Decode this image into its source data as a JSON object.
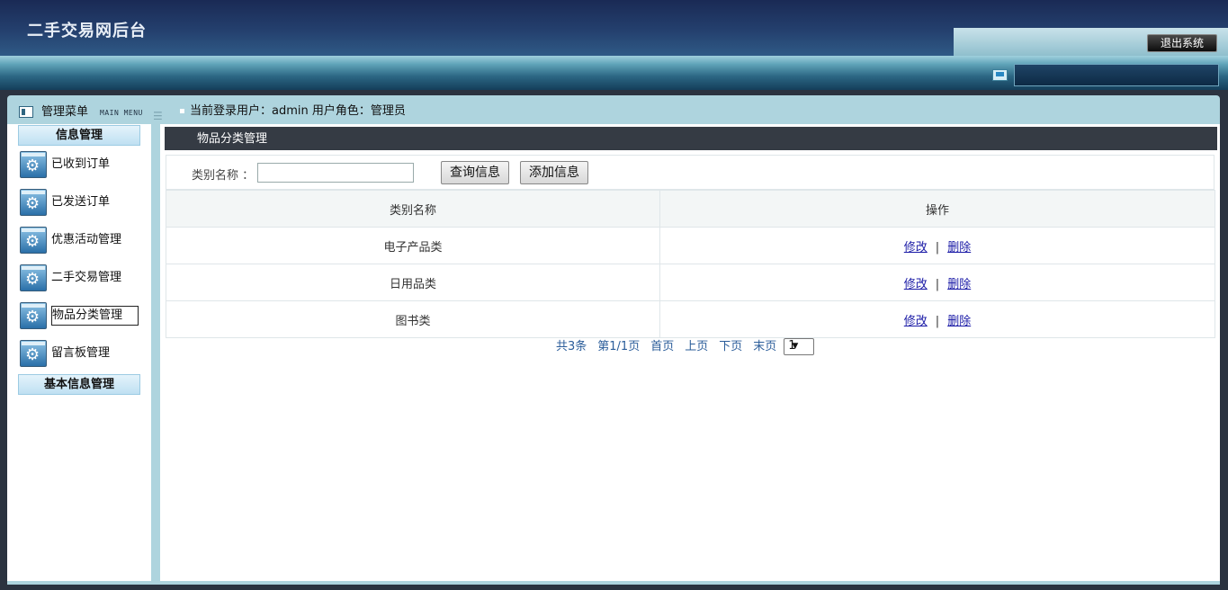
{
  "header": {
    "title": "二手交易网后台",
    "logout_label": "退出系统"
  },
  "menu_head": {
    "title": "管理菜单",
    "subtitle": "MAIN MENU"
  },
  "login_info": {
    "text": "当前登录用户：admin  用户角色：管理员"
  },
  "sidebar": {
    "sections": [
      {
        "label": "信息管理"
      },
      {
        "label": "基本信息管理"
      }
    ],
    "items": [
      {
        "label": "已收到订单"
      },
      {
        "label": "已发送订单"
      },
      {
        "label": "优惠活动管理"
      },
      {
        "label": "二手交易管理"
      },
      {
        "label": "物品分类管理"
      },
      {
        "label": "留言板管理"
      }
    ],
    "active_index": 4
  },
  "panel": {
    "title": "物品分类管理"
  },
  "search": {
    "label": "类别名称 ：",
    "value": "",
    "placeholder": "",
    "query_label": "查询信息",
    "add_label": "添加信息"
  },
  "table": {
    "columns": [
      "类别名称",
      "操作"
    ],
    "rows": [
      {
        "name": "电子产品类",
        "edit": "修改",
        "sep": "|",
        "delete": "删除"
      },
      {
        "name": "日用品类",
        "edit": "修改",
        "sep": "|",
        "delete": "删除"
      },
      {
        "name": "图书类",
        "edit": "修改",
        "sep": "|",
        "delete": "删除"
      }
    ]
  },
  "pager": {
    "total": "共3条",
    "page": "第1/1页",
    "first": "首页",
    "prev": "上页",
    "next": "下页",
    "last": "末页",
    "selected": "1"
  }
}
